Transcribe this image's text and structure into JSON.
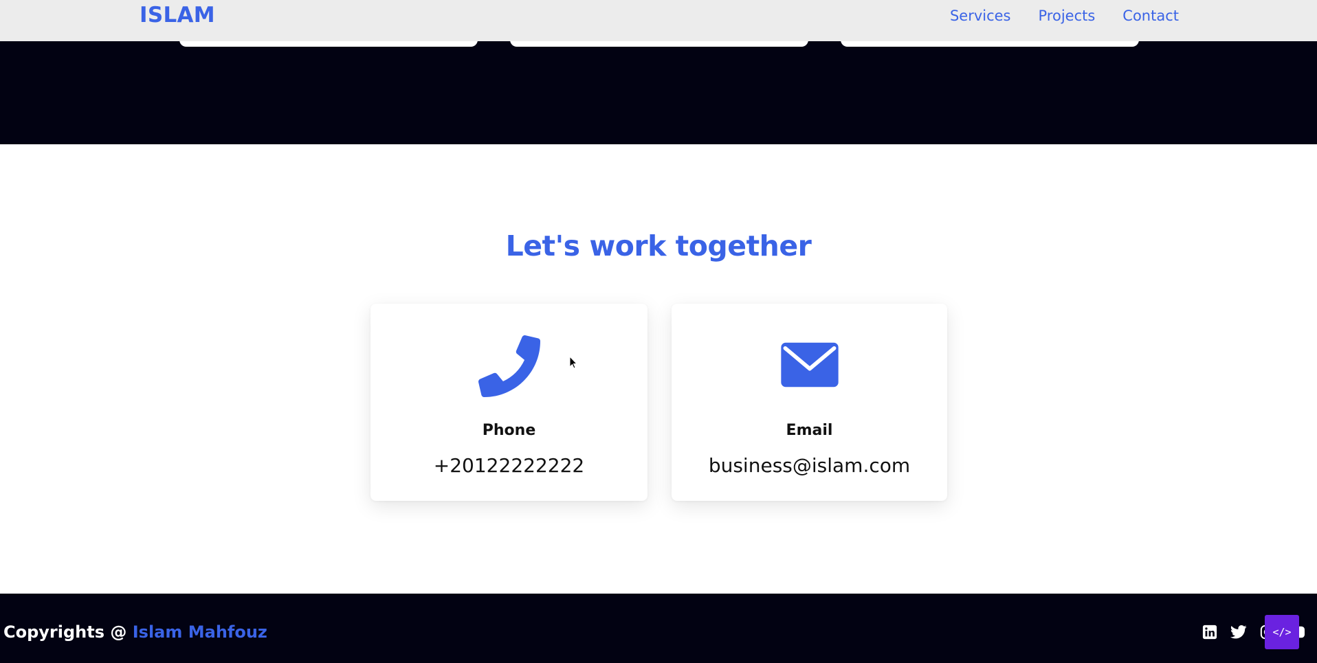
{
  "header": {
    "logo": "ISLAM",
    "nav": [
      {
        "label": "Services"
      },
      {
        "label": "Projects"
      },
      {
        "label": "Contact"
      }
    ]
  },
  "contact": {
    "title": "Let's work together",
    "cards": [
      {
        "icon": "phone-icon",
        "label": "Phone",
        "value": "+20122222222"
      },
      {
        "icon": "envelope-icon",
        "label": "Email",
        "value": "business@islam.com"
      }
    ]
  },
  "footer": {
    "copyright_prefix": "Copyrights @ ",
    "copyright_owner": "Islam Mahfouz",
    "socials": [
      "linkedin-icon",
      "twitter-icon",
      "instagram-icon",
      "youtube-icon"
    ]
  },
  "colors": {
    "accent": "#3a63e6",
    "dark": "#020212",
    "header_bg": "#ececec",
    "badge": "#6a22e0"
  }
}
